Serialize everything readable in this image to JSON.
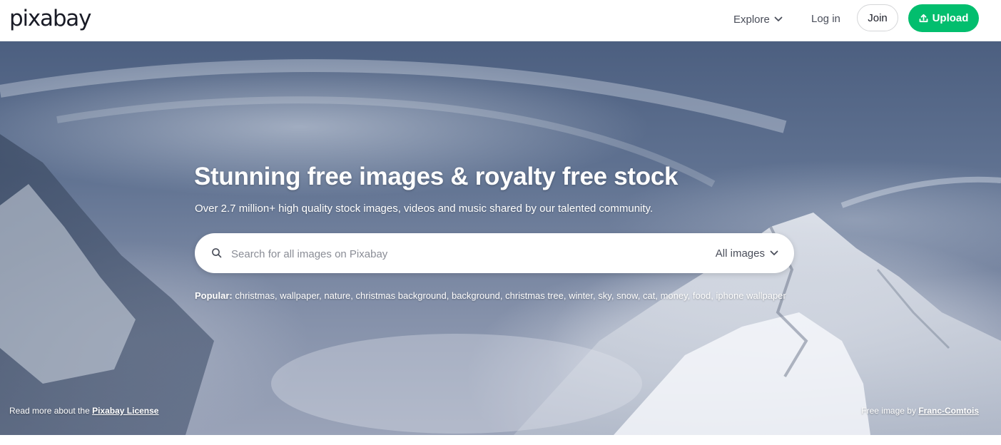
{
  "header": {
    "logo": "pixabay",
    "explore_label": "Explore",
    "login_label": "Log in",
    "join_label": "Join",
    "upload_label": "Upload"
  },
  "hero": {
    "title": "Stunning free images & royalty free stock",
    "subtitle": "Over 2.7 million+ high quality stock images, videos and music shared by our talented community.",
    "search": {
      "placeholder": "Search for all images on Pixabay",
      "value": "",
      "type_selected": "All images"
    },
    "popular_label": "Popular:",
    "popular_tags": [
      "christmas",
      "wallpaper",
      "nature",
      "christmas background",
      "background",
      "christmas tree",
      "winter",
      "sky",
      "snow",
      "cat",
      "money",
      "food",
      "iphone wallpaper"
    ],
    "license_prefix": "Read more about the",
    "license_link": "Pixabay License",
    "credit_prefix": "Free image by",
    "credit_link": "Franc-Comtois"
  },
  "colors": {
    "brand_green": "#02be6e",
    "text_dark": "#191b26"
  },
  "icons": {
    "explore": "chevron-down-icon",
    "upload": "upload-icon",
    "search": "search-icon",
    "type_select": "chevron-down-icon"
  }
}
